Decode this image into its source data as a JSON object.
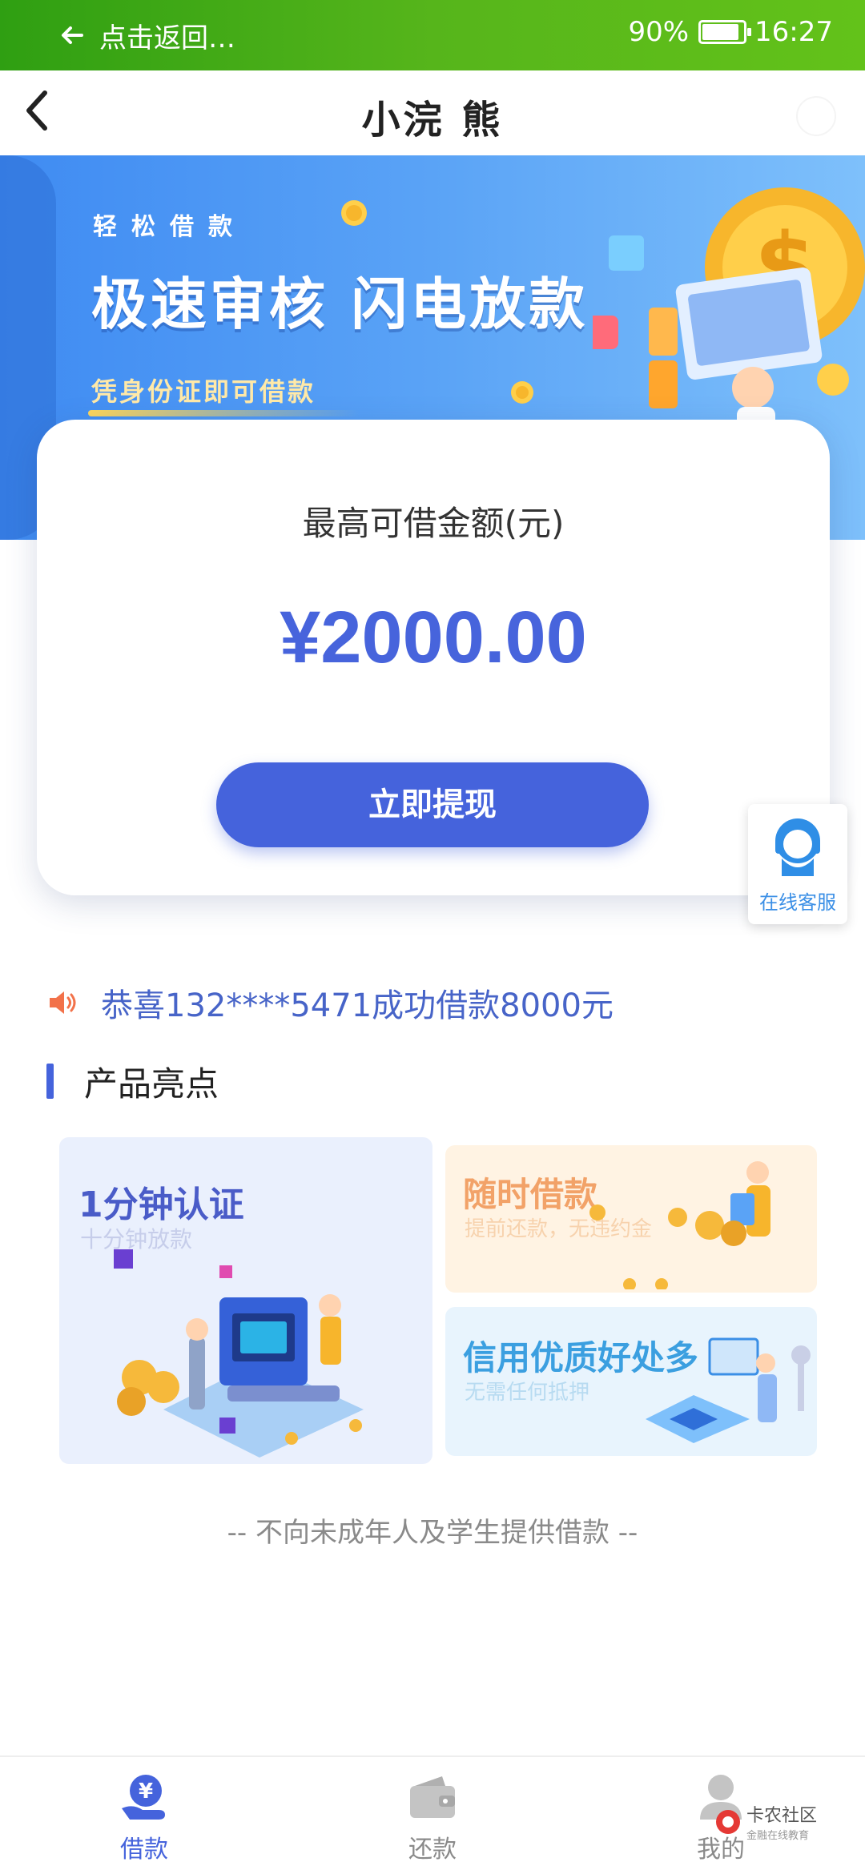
{
  "status_bar": {
    "back_text": "点击返回…",
    "battery_percent": "90%",
    "battery_level": 0.9,
    "time": "16:27"
  },
  "nav": {
    "title": "小浣 熊"
  },
  "banner": {
    "pre_title": "轻松借款",
    "main_title": "极速审核 闪电放款",
    "subtitle": "凭身份证即可借款"
  },
  "card": {
    "label": "最高可借金额(元)",
    "amount": "¥2000.00",
    "button": "立即提现"
  },
  "customer_service": {
    "label": "在线客服"
  },
  "notice": {
    "text": "恭喜132****5471成功借款8000元"
  },
  "highlights": {
    "title": "产品亮点",
    "tiles": [
      {
        "title": "1分钟认证",
        "subtitle": "十分钟放款"
      },
      {
        "title": "随时借款",
        "subtitle": "提前还款，无违约金"
      },
      {
        "title": "信用优质好处多",
        "subtitle": "无需任何抵押"
      }
    ]
  },
  "disclaimer": "-- 不向未成年人及学生提供借款 --",
  "tabbar": {
    "items": [
      {
        "label": "借款",
        "icon": "yen-hand-icon"
      },
      {
        "label": "还款",
        "icon": "wallet-icon"
      },
      {
        "label": "我的",
        "icon": "user-icon"
      }
    ]
  },
  "watermark": {
    "title": "卡农社区",
    "subtitle": "金融在线教育"
  },
  "colors": {
    "primary": "#4563dc",
    "status_bar": "#56b51b",
    "banner": "#5aa3f6"
  }
}
